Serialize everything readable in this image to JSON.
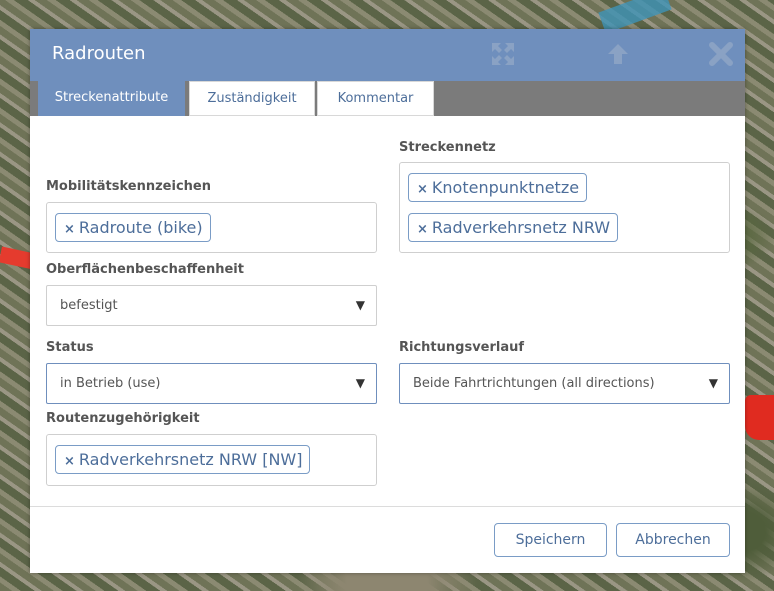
{
  "dialog": {
    "title": "Radrouten",
    "icons": {
      "maximize": "expand-icon",
      "up": "arrow-up-icon",
      "close": "close-icon"
    }
  },
  "tabs": [
    {
      "label": "Streckenattribute",
      "active": true
    },
    {
      "label": "Zuständigkeit",
      "active": false
    },
    {
      "label": "Kommentar",
      "active": false
    }
  ],
  "form": {
    "streckennetz": {
      "label": "Streckennetz",
      "tags": [
        "Knotenpunktnetze",
        "Radverkehrsnetz NRW"
      ]
    },
    "mobilitaet": {
      "label": "Mobilitätskennzeichen",
      "tags": [
        "Radroute (bike)"
      ]
    },
    "oberflaeche": {
      "label": "Oberflächenbeschaffenheit",
      "value": "befestigt"
    },
    "status": {
      "label": "Status",
      "value": "in Betrieb (use)"
    },
    "richtung": {
      "label": "Richtungsverlauf",
      "value": "Beide Fahrtrichtungen (all directions)"
    },
    "routen": {
      "label": "Routenzugehörigkeit",
      "tags": [
        "Radverkehrsnetz NRW [NW]"
      ]
    },
    "tag_remove_glyph": "×",
    "dropdown_glyph": "▼"
  },
  "buttons": {
    "save": "Speichern",
    "cancel": "Abbrechen"
  },
  "colors": {
    "accent": "#6f8fbd",
    "tab_bar": "#7b7b7b",
    "link_text": "#4d6e9a"
  }
}
